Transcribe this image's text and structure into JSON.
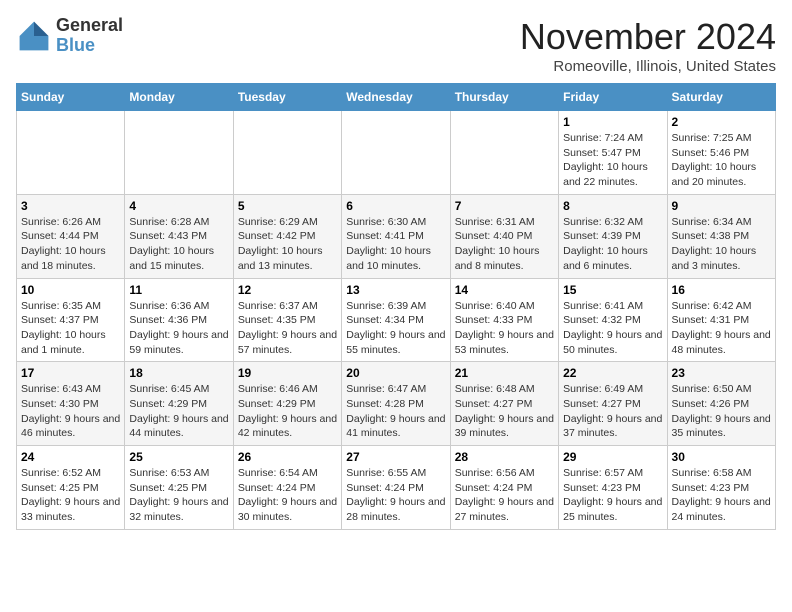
{
  "logo": {
    "general": "General",
    "blue": "Blue"
  },
  "header": {
    "month": "November 2024",
    "location": "Romeoville, Illinois, United States"
  },
  "weekdays": [
    "Sunday",
    "Monday",
    "Tuesday",
    "Wednesday",
    "Thursday",
    "Friday",
    "Saturday"
  ],
  "weeks": [
    [
      {
        "day": "",
        "info": ""
      },
      {
        "day": "",
        "info": ""
      },
      {
        "day": "",
        "info": ""
      },
      {
        "day": "",
        "info": ""
      },
      {
        "day": "",
        "info": ""
      },
      {
        "day": "1",
        "info": "Sunrise: 7:24 AM\nSunset: 5:47 PM\nDaylight: 10 hours and 22 minutes."
      },
      {
        "day": "2",
        "info": "Sunrise: 7:25 AM\nSunset: 5:46 PM\nDaylight: 10 hours and 20 minutes."
      }
    ],
    [
      {
        "day": "3",
        "info": "Sunrise: 6:26 AM\nSunset: 4:44 PM\nDaylight: 10 hours and 18 minutes."
      },
      {
        "day": "4",
        "info": "Sunrise: 6:28 AM\nSunset: 4:43 PM\nDaylight: 10 hours and 15 minutes."
      },
      {
        "day": "5",
        "info": "Sunrise: 6:29 AM\nSunset: 4:42 PM\nDaylight: 10 hours and 13 minutes."
      },
      {
        "day": "6",
        "info": "Sunrise: 6:30 AM\nSunset: 4:41 PM\nDaylight: 10 hours and 10 minutes."
      },
      {
        "day": "7",
        "info": "Sunrise: 6:31 AM\nSunset: 4:40 PM\nDaylight: 10 hours and 8 minutes."
      },
      {
        "day": "8",
        "info": "Sunrise: 6:32 AM\nSunset: 4:39 PM\nDaylight: 10 hours and 6 minutes."
      },
      {
        "day": "9",
        "info": "Sunrise: 6:34 AM\nSunset: 4:38 PM\nDaylight: 10 hours and 3 minutes."
      }
    ],
    [
      {
        "day": "10",
        "info": "Sunrise: 6:35 AM\nSunset: 4:37 PM\nDaylight: 10 hours and 1 minute."
      },
      {
        "day": "11",
        "info": "Sunrise: 6:36 AM\nSunset: 4:36 PM\nDaylight: 9 hours and 59 minutes."
      },
      {
        "day": "12",
        "info": "Sunrise: 6:37 AM\nSunset: 4:35 PM\nDaylight: 9 hours and 57 minutes."
      },
      {
        "day": "13",
        "info": "Sunrise: 6:39 AM\nSunset: 4:34 PM\nDaylight: 9 hours and 55 minutes."
      },
      {
        "day": "14",
        "info": "Sunrise: 6:40 AM\nSunset: 4:33 PM\nDaylight: 9 hours and 53 minutes."
      },
      {
        "day": "15",
        "info": "Sunrise: 6:41 AM\nSunset: 4:32 PM\nDaylight: 9 hours and 50 minutes."
      },
      {
        "day": "16",
        "info": "Sunrise: 6:42 AM\nSunset: 4:31 PM\nDaylight: 9 hours and 48 minutes."
      }
    ],
    [
      {
        "day": "17",
        "info": "Sunrise: 6:43 AM\nSunset: 4:30 PM\nDaylight: 9 hours and 46 minutes."
      },
      {
        "day": "18",
        "info": "Sunrise: 6:45 AM\nSunset: 4:29 PM\nDaylight: 9 hours and 44 minutes."
      },
      {
        "day": "19",
        "info": "Sunrise: 6:46 AM\nSunset: 4:29 PM\nDaylight: 9 hours and 42 minutes."
      },
      {
        "day": "20",
        "info": "Sunrise: 6:47 AM\nSunset: 4:28 PM\nDaylight: 9 hours and 41 minutes."
      },
      {
        "day": "21",
        "info": "Sunrise: 6:48 AM\nSunset: 4:27 PM\nDaylight: 9 hours and 39 minutes."
      },
      {
        "day": "22",
        "info": "Sunrise: 6:49 AM\nSunset: 4:27 PM\nDaylight: 9 hours and 37 minutes."
      },
      {
        "day": "23",
        "info": "Sunrise: 6:50 AM\nSunset: 4:26 PM\nDaylight: 9 hours and 35 minutes."
      }
    ],
    [
      {
        "day": "24",
        "info": "Sunrise: 6:52 AM\nSunset: 4:25 PM\nDaylight: 9 hours and 33 minutes."
      },
      {
        "day": "25",
        "info": "Sunrise: 6:53 AM\nSunset: 4:25 PM\nDaylight: 9 hours and 32 minutes."
      },
      {
        "day": "26",
        "info": "Sunrise: 6:54 AM\nSunset: 4:24 PM\nDaylight: 9 hours and 30 minutes."
      },
      {
        "day": "27",
        "info": "Sunrise: 6:55 AM\nSunset: 4:24 PM\nDaylight: 9 hours and 28 minutes."
      },
      {
        "day": "28",
        "info": "Sunrise: 6:56 AM\nSunset: 4:24 PM\nDaylight: 9 hours and 27 minutes."
      },
      {
        "day": "29",
        "info": "Sunrise: 6:57 AM\nSunset: 4:23 PM\nDaylight: 9 hours and 25 minutes."
      },
      {
        "day": "30",
        "info": "Sunrise: 6:58 AM\nSunset: 4:23 PM\nDaylight: 9 hours and 24 minutes."
      }
    ]
  ]
}
